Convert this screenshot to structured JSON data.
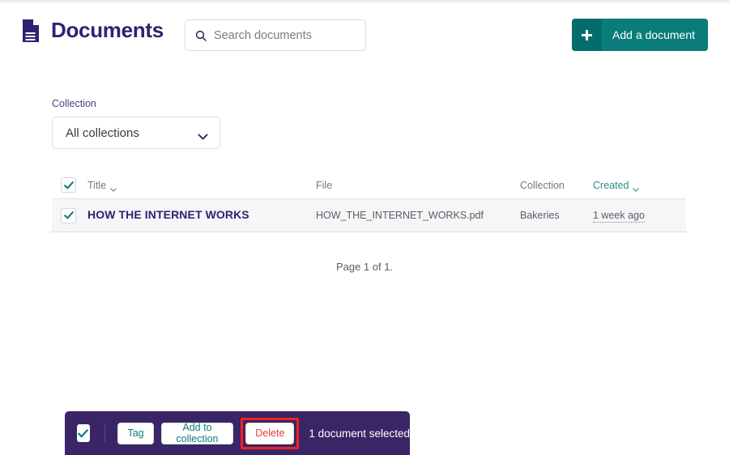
{
  "header": {
    "title": "Documents",
    "doc_icon": "document-icon",
    "search": {
      "icon": "search-icon",
      "placeholder": "Search documents",
      "value": ""
    },
    "add_button": {
      "icon": "plus-icon",
      "label": "Add a document"
    }
  },
  "filter": {
    "label": "Collection",
    "selected": "All collections",
    "chevron": "chevron-down-icon",
    "options": [
      "All collections"
    ]
  },
  "table": {
    "select_all_checked": true,
    "columns": [
      {
        "key": "title",
        "label": "Title",
        "sortable": true,
        "active": true
      },
      {
        "key": "file",
        "label": "File",
        "sortable": false,
        "active": false
      },
      {
        "key": "collection",
        "label": "Collection",
        "sortable": false,
        "active": false
      },
      {
        "key": "created",
        "label": "Created",
        "sortable": true,
        "active": false
      }
    ],
    "rows": [
      {
        "checked": true,
        "title": "HOW THE INTERNET WORKS",
        "file": "HOW_THE_INTERNET_WORKS.pdf",
        "collection": "Bakeries",
        "created": "1 week ago"
      }
    ]
  },
  "pagination": {
    "text": "Page 1 of 1."
  },
  "action_bar": {
    "checkbox_checked": true,
    "buttons": [
      {
        "key": "tag",
        "label": "Tag",
        "danger": false
      },
      {
        "key": "add_to_collection",
        "label": "Add to collection",
        "danger": false
      }
    ],
    "delete_button": {
      "label": "Delete",
      "danger": true,
      "highlighted": true
    },
    "status": "1 document selected"
  },
  "colors": {
    "brand_purple": "#2e2272",
    "bar_purple": "#3a2566",
    "teal": "#0a7c7a",
    "teal_dark": "#046d6c",
    "danger_red": "#e53b3b",
    "highlight_red": "#f4221f",
    "row_bg": "#f6f6f8"
  }
}
